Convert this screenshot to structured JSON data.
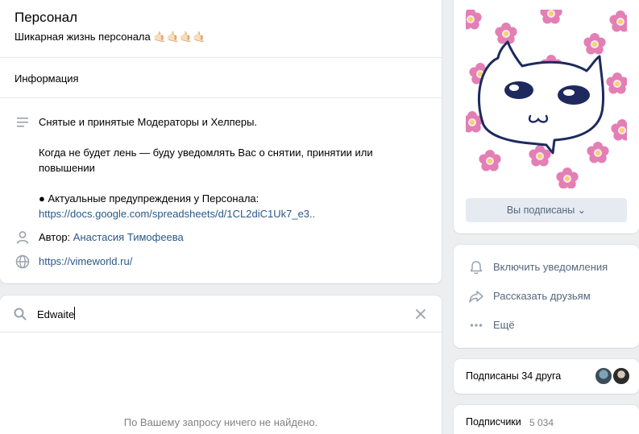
{
  "group": {
    "title": "Персонал",
    "status": "Шикарная жизнь персонала",
    "status_emoji": "🤙🏻🤙🏻🤙🏻🤙🏻"
  },
  "info": {
    "section_title": "Информация",
    "description_lines": [
      "Снятые и принятые Модераторы и Хелперы.",
      "Когда не будет лень — буду уведомлять Вас о снятии, принятии или",
      "повышении",
      "● Актуальные предупреждения у Персонала:"
    ],
    "description_link": "https://docs.google.com/spreadsheets/d/1CL2diC1Uk7_e3..",
    "author_label": "Автор:",
    "author_name": "Анастасия Тимофеева",
    "website": "https://vimeworld.ru/"
  },
  "search": {
    "value": "Edwaite",
    "placeholder": "",
    "empty_message": "По Вашему запросу ничего не найдено."
  },
  "sidebar": {
    "subscribe_button": "Вы подписаны ⌄",
    "actions": [
      {
        "label": "Включить уведомления",
        "icon": "bell-icon"
      },
      {
        "label": "Рассказать друзьям",
        "icon": "share-icon"
      },
      {
        "label": "Ещё",
        "icon": "more-icon"
      }
    ],
    "friends_label": "Подписаны 34 друга",
    "followers_label": "Подписчики",
    "followers_count": "5 034"
  },
  "colors": {
    "link": "#2a5885",
    "background": "#edeef0",
    "button_bg": "#e5ebf1",
    "muted": "#828282",
    "flower_pink": "#e37fb5",
    "flower_yellow": "#f7d26a",
    "cat_outline": "#1e2a5e"
  }
}
